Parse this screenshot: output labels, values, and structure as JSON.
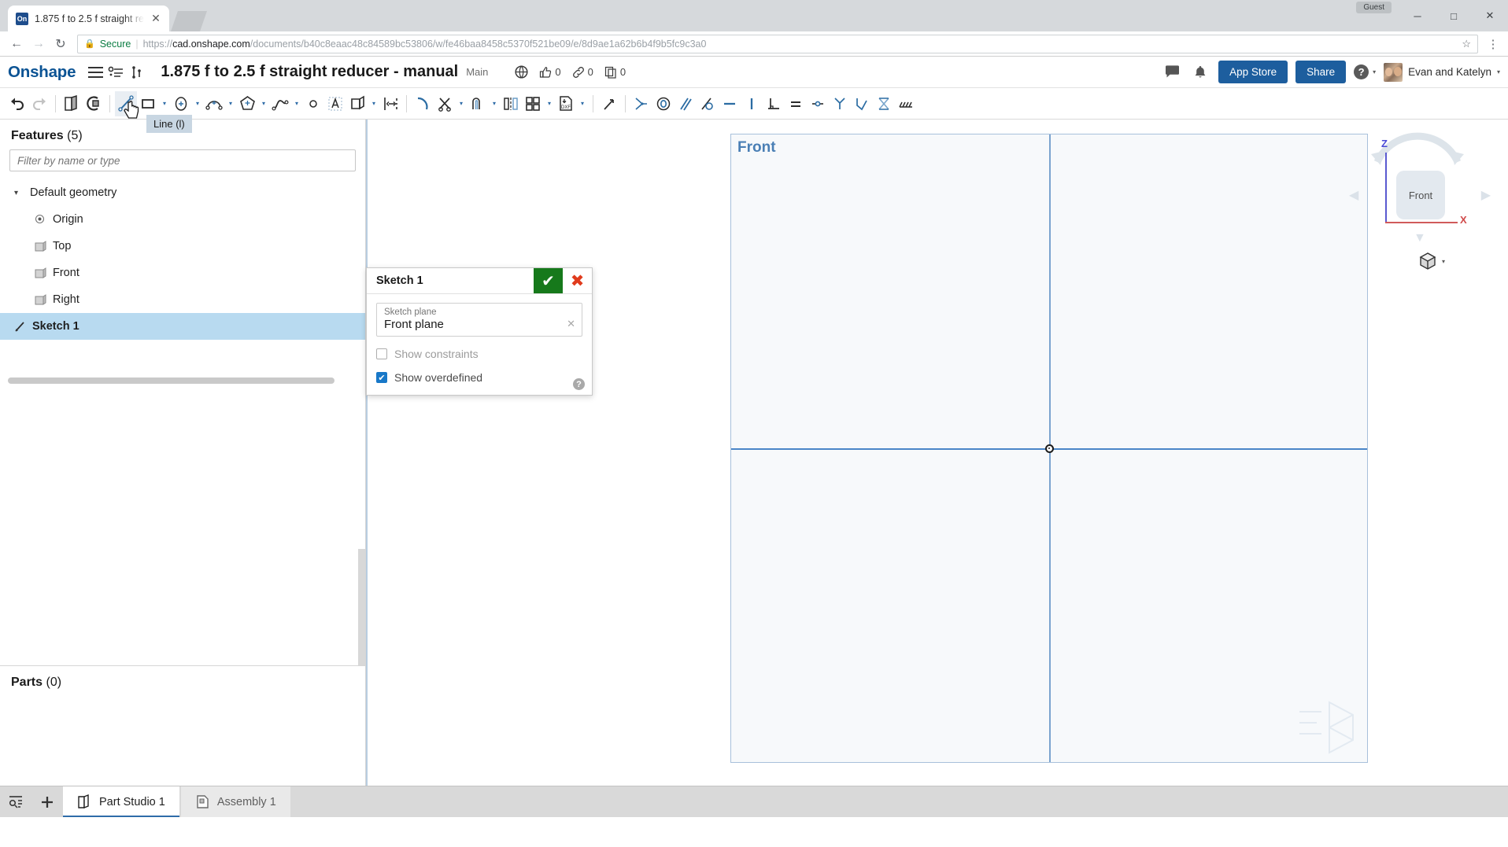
{
  "browser": {
    "tab": {
      "title": "1.875 f to 2.5 f straight re",
      "favicon_text": "On",
      "close_label": "✕"
    },
    "guest_label": "Guest",
    "window": {
      "minimize": "─",
      "maximize": "□",
      "close": "✕"
    },
    "nav": {
      "back": "←",
      "forward": "→",
      "reload": "↻"
    },
    "security_label": "Secure",
    "url_prefix": "https://",
    "url_domain": "cad.onshape.com",
    "url_path": "/documents/b40c8eaac48c84589bc53806/w/fe46baa8458c5370f521be09/e/8d9ae1a62b6b4f9b5fc9c3a0",
    "bookmark_icon": "☆",
    "menu_icon": "⋮"
  },
  "header": {
    "logo": "Onshape",
    "document_title": "1.875 f to 2.5 f straight reducer - manual",
    "workspace": "Main",
    "likes_count": "0",
    "links_count": "0",
    "copies_count": "0",
    "app_store_label": "App Store",
    "share_label": "Share",
    "help_label": "?",
    "user_name": "Evan and Katelyn",
    "user_caret": "▾"
  },
  "toolbar": {
    "undo": "undo",
    "redo": "redo",
    "items": [
      {
        "name": "new-sketch",
        "caret": false
      },
      {
        "name": "sketch-entities",
        "caret": false
      },
      {
        "name": "line",
        "caret": false,
        "selected": true
      },
      {
        "name": "rectangle",
        "caret": true
      },
      {
        "name": "circle",
        "caret": true
      },
      {
        "name": "arc",
        "caret": true
      },
      {
        "name": "polygon",
        "caret": true
      },
      {
        "name": "spline",
        "caret": true
      },
      {
        "name": "point",
        "caret": false
      },
      {
        "name": "text",
        "caret": false
      },
      {
        "name": "use-project",
        "caret": true
      },
      {
        "name": "dimension",
        "caret": false
      },
      {
        "name": "fillet",
        "caret": false
      },
      {
        "name": "trim",
        "caret": true
      },
      {
        "name": "offset",
        "caret": true
      },
      {
        "name": "mirror",
        "caret": false
      },
      {
        "name": "linear-pattern",
        "caret": true
      },
      {
        "name": "import-dxf",
        "caret": true
      },
      {
        "name": "construction",
        "caret": false
      }
    ],
    "constraints": [
      "coincident",
      "concentric",
      "parallel",
      "tangent",
      "horizontal",
      "vertical",
      "perpendicular",
      "equal",
      "midpoint",
      "symmetric",
      "fix",
      "normal",
      "pattern"
    ],
    "tooltip": "Line (l)"
  },
  "features_panel": {
    "title_bold": "Features",
    "title_count": "(5)",
    "filter_placeholder": "Filter by name or type",
    "tree": [
      {
        "label": "Default geometry",
        "type": "group",
        "expanded": true
      },
      {
        "label": "Origin",
        "type": "origin"
      },
      {
        "label": "Top",
        "type": "plane"
      },
      {
        "label": "Front",
        "type": "plane"
      },
      {
        "label": "Right",
        "type": "plane"
      },
      {
        "label": "Sketch 1",
        "type": "sketch",
        "selected": true
      }
    ],
    "parts_title_bold": "Parts",
    "parts_title_count": "(0)"
  },
  "sketch_dialog": {
    "title": "Sketch 1",
    "ok_glyph": "✔",
    "cancel_glyph": "✖",
    "plane_field_label": "Sketch plane",
    "plane_field_value": "Front plane",
    "plane_clear_glyph": "✕",
    "show_constraints_label": "Show constraints",
    "show_constraints_checked": false,
    "show_overdefined_label": "Show overdefined",
    "show_overdefined_checked": true,
    "check_glyph": "✔",
    "help_glyph": "?"
  },
  "canvas": {
    "plane_label": "Front",
    "viewcube": {
      "face_label": "Front",
      "axis_z": "Z",
      "axis_x": "X",
      "axis_z_color": "#4a4ad6",
      "axis_x_color": "#d04a4a",
      "left_arrow": "◀",
      "right_arrow": "▶",
      "down_arrow": "▼",
      "view_caret": "▾"
    }
  },
  "bottom_tabs": {
    "filter_icon": "tab-filter-icon",
    "add_icon": "+",
    "tabs": [
      {
        "label": "Part Studio 1",
        "active": true
      },
      {
        "label": "Assembly 1",
        "active": false
      }
    ]
  }
}
